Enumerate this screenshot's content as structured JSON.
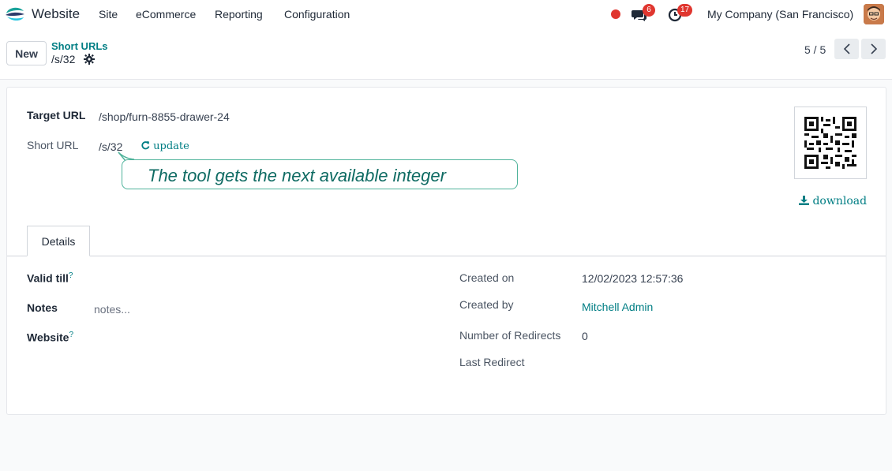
{
  "nav": {
    "app_name": "Website",
    "menu": [
      "Site",
      "eCommerce",
      "Reporting",
      "Configuration"
    ],
    "chat_count": "6",
    "activity_count": "17",
    "company": "My Company (San Francisco)"
  },
  "control": {
    "new_label": "New",
    "breadcrumb_parent": "Short URLs",
    "breadcrumb_current": "/s/32",
    "pager": "5 / 5"
  },
  "form": {
    "target_url_label": "Target URL",
    "target_url_value": "/shop/furn-8855-drawer-24",
    "short_url_label": "Short URL",
    "short_url_value": "/s/32",
    "update_label": "update",
    "callout": "The tool gets the next available integer",
    "download_label": "download",
    "tab_details": "Details",
    "valid_till_label": "Valid till",
    "notes_label": "Notes",
    "notes_placeholder": "notes...",
    "website_label": "Website",
    "help_mark": "?",
    "created_on_label": "Created on",
    "created_on_value": "12/02/2023 12:57:36",
    "created_by_label": "Created by",
    "created_by_value": "Mitchell Admin",
    "redirects_label": "Number of Redirects",
    "redirects_value": "0",
    "last_redirect_label": "Last Redirect"
  },
  "colors": {
    "accent": "#017e84",
    "badge": "#e0362f",
    "callout_border": "#4fb39b"
  }
}
